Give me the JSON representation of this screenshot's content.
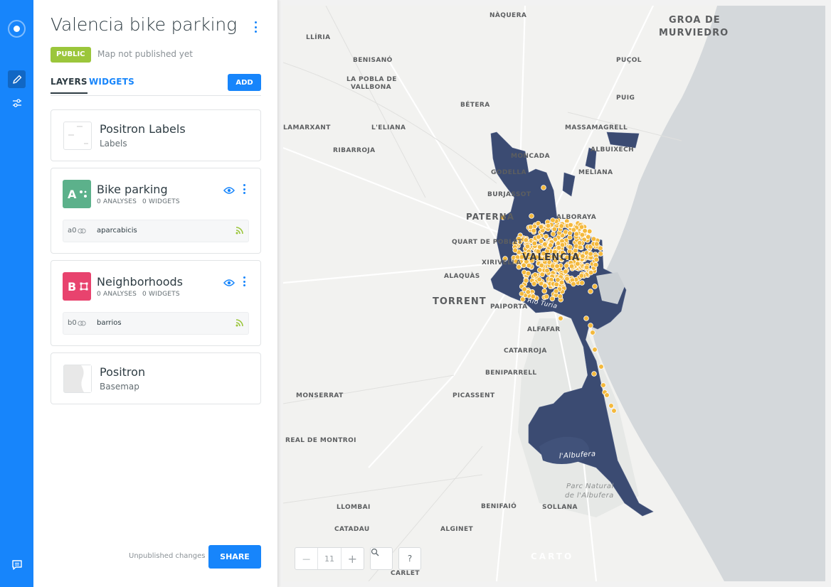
{
  "map_title": "Valencia bike parking",
  "privacy_badge": "PUBLIC",
  "publish_status": "Map not published yet",
  "tabs": {
    "layers": "LAYERS",
    "widgets": "WIDGETS"
  },
  "add_label": "ADD",
  "layers": [
    {
      "name": "Positron Labels",
      "subtitle": "Labels"
    },
    {
      "letter": "A",
      "name": "Bike parking",
      "analyses": "0 ANALYSES",
      "widgets": "0 WIDGETS",
      "source_id": "a0",
      "source_name": "aparcabicis",
      "color": "#5cb18b"
    },
    {
      "letter": "B",
      "name": "Neighborhoods",
      "analyses": "0 ANALYSES",
      "widgets": "0 WIDGETS",
      "source_id": "b0",
      "source_name": "barrios",
      "color": "#e8436e"
    },
    {
      "name": "Positron",
      "subtitle": "Basemap"
    }
  ],
  "unpublished_changes": "Unpublished changes",
  "share_label": "SHARE",
  "map": {
    "zoom_level": "11",
    "zoom_out": "—",
    "zoom_in": "+",
    "help": "?",
    "attribution": "CARTO",
    "polygon_color": "#3b4b72",
    "point_color": "#f4b93d",
    "place_labels": {
      "naquera": "NÀQUERA",
      "groa1": "GROA DE",
      "groa2": "MURVIEDRO",
      "lliria": "LLÍRIA",
      "benisano": "BENISANÓ",
      "pobla1": "LA POBLA DE",
      "pobla2": "VALLBONA",
      "pucol": "PUÇOL",
      "puig": "PUIG",
      "betera": "BÉTERA",
      "lamarxant": "LAMARXANT",
      "leliana": "L'ELIANA",
      "massamagrell": "MASSAMAGRELL",
      "ribarroja": "RIBARROJA",
      "albuixech": "ALBUIXECH",
      "moncada": "MONCADA",
      "godella": "GODELLA",
      "meliana": "MELIANA",
      "burjassot": "BURJASSOT",
      "paterna": "PATERNA",
      "alboraya": "ALBORAYA",
      "quart": "QUART DE POBLET",
      "valencia": "VALENCIA",
      "xirivella": "XIRIVELLA",
      "alaquas": "ALAQUÀS",
      "torrent": "TORRENT",
      "paiporta": "PAIPORTA",
      "rioturia": "Río Turia",
      "alfafar": "ALFAFAR",
      "catarroja": "CATARROJA",
      "beniparrell": "BENIPARRELL",
      "monserrat": "MONSERRAT",
      "picassent": "PICASSENT",
      "realmontroi": "REAL DE MONTROI",
      "albufera": "l'Albufera",
      "parc1": "Parc Natural",
      "parc2": "de l'Albufera",
      "llombai": "LLOMBAI",
      "benifaio": "BENIFAIÓ",
      "sollana": "SOLLANA",
      "catadau": "CATADAU",
      "alginet": "ALGINET",
      "carlet": "CARLET"
    }
  }
}
